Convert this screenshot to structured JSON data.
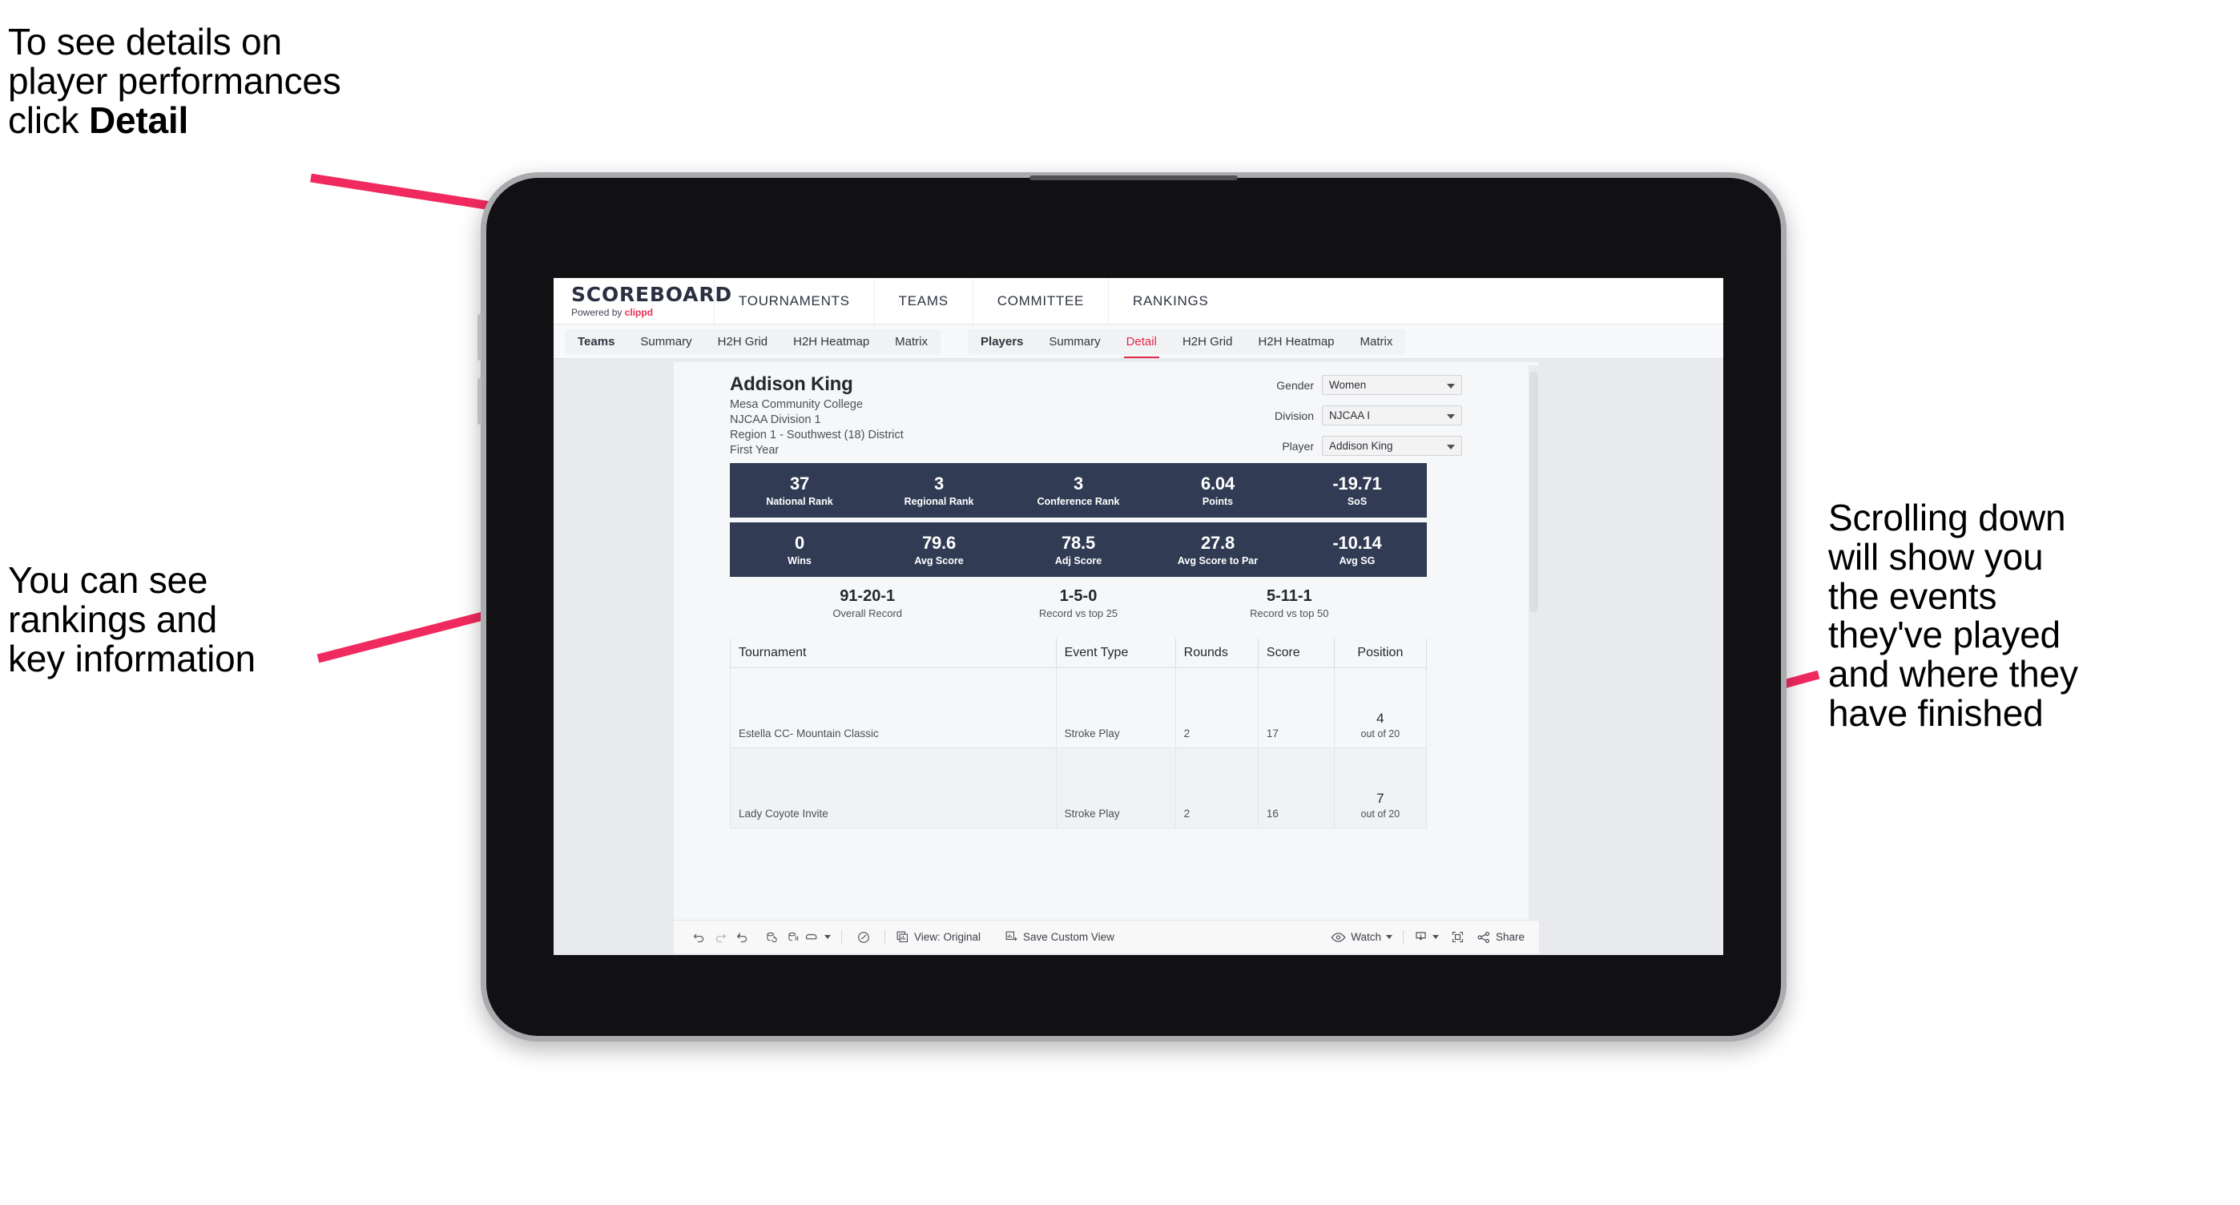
{
  "annotations": {
    "top_left": "To see details on\nplayer performances\nclick ",
    "top_left_bold": "Detail",
    "mid_left": "You can see\nrankings and\nkey information",
    "right": "Scrolling down\nwill show you\nthe events\nthey've played\nand where they\nhave finished",
    "arrow_color": "#F02A5E"
  },
  "app": {
    "brand": {
      "title": "SCOREBOARD",
      "powered_prefix": "Powered by ",
      "powered_name": "clippd"
    },
    "topnav": [
      "TOURNAMENTS",
      "TEAMS",
      "COMMITTEE",
      "RANKINGS"
    ],
    "tabs_team": [
      "Teams",
      "Summary",
      "H2H Grid",
      "H2H Heatmap",
      "Matrix"
    ],
    "tabs_player": [
      "Players",
      "Summary",
      "Detail",
      "H2H Grid",
      "H2H Heatmap",
      "Matrix"
    ],
    "active_tab": "Detail",
    "accent_color": "#E6294F",
    "statbar_color": "#313C54"
  },
  "player": {
    "name": "Addison King",
    "school": "Mesa Community College",
    "division": "NJCAA Division 1",
    "region": "Region 1 - Southwest (18) District",
    "year": "First Year"
  },
  "selectors": [
    {
      "label": "Gender",
      "value": "Women"
    },
    {
      "label": "Division",
      "value": "NJCAA I"
    },
    {
      "label": "Player",
      "value": "Addison King"
    }
  ],
  "stats_row1": [
    {
      "value": "37",
      "label": "National Rank"
    },
    {
      "value": "3",
      "label": "Regional Rank"
    },
    {
      "value": "3",
      "label": "Conference Rank"
    },
    {
      "value": "6.04",
      "label": "Points"
    },
    {
      "value": "-19.71",
      "label": "SoS"
    }
  ],
  "stats_row2": [
    {
      "value": "0",
      "label": "Wins"
    },
    {
      "value": "79.6",
      "label": "Avg Score"
    },
    {
      "value": "78.5",
      "label": "Adj Score"
    },
    {
      "value": "27.8",
      "label": "Avg Score to Par"
    },
    {
      "value": "-10.14",
      "label": "Avg SG"
    }
  ],
  "records": [
    {
      "value": "91-20-1",
      "label": "Overall Record"
    },
    {
      "value": "1-5-0",
      "label": "Record vs top 25"
    },
    {
      "value": "5-11-1",
      "label": "Record vs top 50"
    }
  ],
  "table": {
    "headers": [
      "Tournament",
      "Event Type",
      "Rounds",
      "Score",
      "Position"
    ],
    "rows": [
      {
        "tournament": "Estella CC- Mountain Classic",
        "event_type": "Stroke Play",
        "rounds": "2",
        "score": "17",
        "position": "4",
        "position_sub": "out of 20"
      },
      {
        "tournament": "Lady Coyote Invite",
        "event_type": "Stroke Play",
        "rounds": "2",
        "score": "16",
        "position": "7",
        "position_sub": "out of 20"
      }
    ]
  },
  "toolbar": {
    "view_label": "View: Original",
    "save_label": "Save Custom View",
    "watch_label": "Watch",
    "share_label": "Share"
  }
}
